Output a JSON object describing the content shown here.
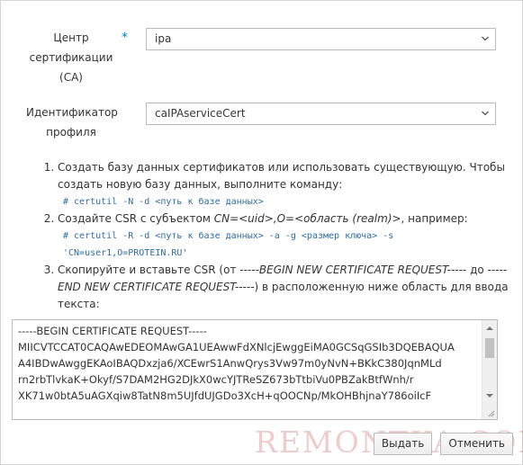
{
  "form": {
    "ca": {
      "label": "Центр сертификации (CA)",
      "required_mark": "*",
      "selected": "ipa"
    },
    "profile": {
      "label": "Идентификатор профиля",
      "selected": "caIPAserviceCert"
    }
  },
  "instructions": {
    "step1_text": "Создать базу данных сертификатов или использовать существующую. Чтобы создать новую базу данных, выполните команду:",
    "step1_code": "# certutil -N -d <путь к базе данных>",
    "step2_prefix": "Создайте CSR с субъектом ",
    "step2_subject": "CN=<uid>,O=<область (realm)>",
    "step2_suffix": ", например:",
    "step2_code1": "# certutil -R -d <путь к базе данных> -a -g <размер ключа> -s",
    "step2_code2": "'CN=user1,O=PROTEIN.RU'",
    "step3_prefix": "Скопируйте и вставьте CSR (от ",
    "step3_begin": "-----BEGIN NEW CERTIFICATE REQUEST-----",
    "step3_mid": " до ",
    "step3_end": "-----END NEW CERTIFICATE REQUEST-----",
    "step3_suffix": ") в расположенную ниже область для ввода текста:"
  },
  "csr": {
    "lines": [
      "-----BEGIN CERTIFICATE REQUEST-----",
      "MIICVTCCAT0CAQAwEDEOMAwGA1UEAwwFdXNlcjEwggEiMA0GCSqGSIb3DQEBAQUA",
      "A4IBDwAwggEKAoIBAQDxzja6/XCEwrS1AnwQrys3Vw97m0yNvN+BKkC380JqnMLd",
      "rn2rbTlvkaK+Okyf/S7DAM2HG2DJkX0wcYJTReSZ673bTtbiVu0PBZakBtfWnh/r",
      "XK71w0btA5uAGXqiw8TatN8m5UJfdUJGDo3XcH+qOOCNp/MkOHBhjnaY786oiIcF"
    ]
  },
  "buttons": {
    "submit": "Выдать",
    "cancel": "Отменить"
  },
  "watermark": "REMONTKA.COM"
}
